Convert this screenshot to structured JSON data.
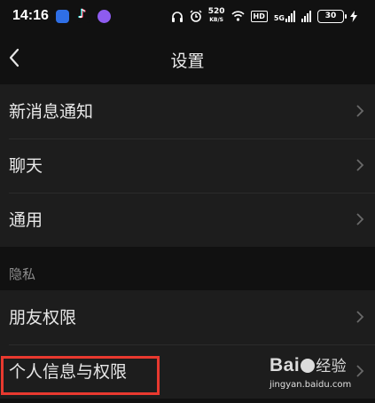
{
  "status_bar": {
    "time": "14:16",
    "net_speed_value": "520",
    "net_speed_unit": "KB/S",
    "hd_badge": "HD",
    "signal_label": "5G",
    "battery": "30"
  },
  "header": {
    "title": "设置"
  },
  "sections": {
    "general": {
      "items": [
        {
          "label": "新消息通知"
        },
        {
          "label": "聊天"
        },
        {
          "label": "通用"
        }
      ]
    },
    "privacy": {
      "header": "隐私",
      "items": [
        {
          "label": "朋友权限"
        },
        {
          "label": "个人信息与权限"
        }
      ]
    }
  },
  "watermark": {
    "logo_text_a": "Bai",
    "logo_text_b": "经验",
    "url": "jingyan.baidu.com"
  },
  "colors": {
    "background": "#111111",
    "row_background": "#1d1d1d",
    "highlight_box": "#e8392f"
  }
}
